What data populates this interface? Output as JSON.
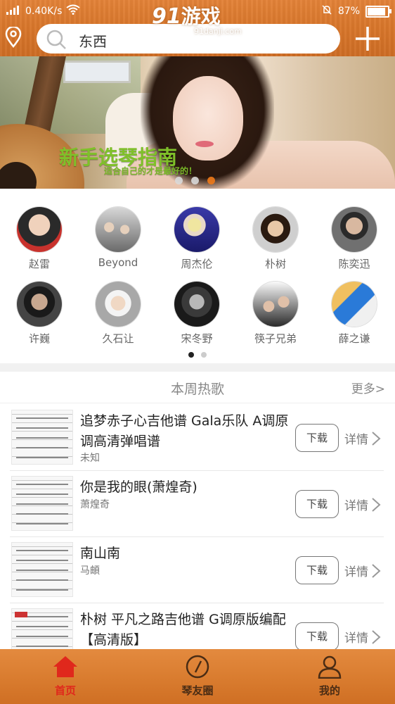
{
  "status_bar": {
    "network": "0.40K/s",
    "battery": "87%"
  },
  "watermark": {
    "logo_number": "91",
    "logo_text": "游戏",
    "url": "91danji.com"
  },
  "header": {
    "location_icon": "location-pin-icon",
    "search_value": "东西",
    "add_icon": "plus-icon"
  },
  "banner": {
    "title": "新手选琴指南",
    "subtitle": "适合自己的才是最好的！",
    "slide_count": 3,
    "active_slide": 3
  },
  "artists": [
    {
      "name": "赵雷"
    },
    {
      "name": "Beyond"
    },
    {
      "name": "周杰伦"
    },
    {
      "name": "朴树"
    },
    {
      "name": "陈奕迅"
    },
    {
      "name": "许巍"
    },
    {
      "name": "久石让"
    },
    {
      "name": "宋冬野"
    },
    {
      "name": "筷子兄弟"
    },
    {
      "name": "薛之谦"
    }
  ],
  "hot_songs": {
    "title": "本周热歌",
    "more_label": "更多>",
    "download_label": "下载",
    "detail_label": "详情",
    "items": [
      {
        "title": "追梦赤子心吉他谱 Gala乐队 A调原调高清弹唱谱",
        "artist": "未知"
      },
      {
        "title": "你是我的眼(萧煌奇)",
        "artist": "萧煌奇"
      },
      {
        "title": "南山南",
        "artist": "马頔"
      },
      {
        "title": "朴树 平凡之路吉他谱 G调原版编配【高清版】",
        "artist": ""
      }
    ]
  },
  "bottom_nav": [
    {
      "label": "首页",
      "icon": "home-icon",
      "active": true
    },
    {
      "label": "琴友圈",
      "icon": "compass-icon",
      "active": false
    },
    {
      "label": "我的",
      "icon": "user-icon",
      "active": false
    }
  ],
  "colors": {
    "accent": "#f07a1a",
    "nav_active": "#e0281c",
    "nav_inactive": "#4a2c14",
    "banner_title": "#7fc02a"
  }
}
